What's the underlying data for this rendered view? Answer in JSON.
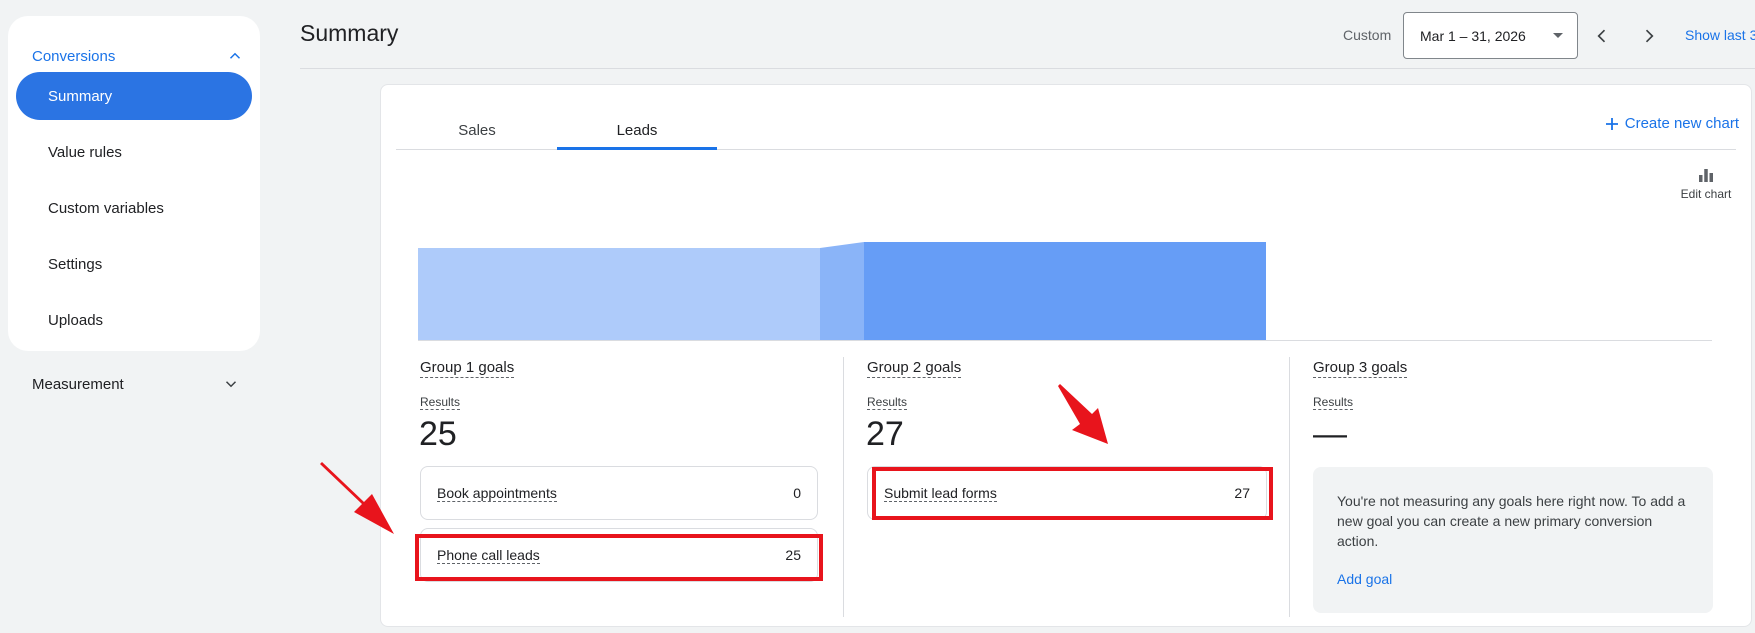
{
  "sidebar": {
    "header": "Conversions",
    "items": [
      {
        "label": "Summary",
        "active": true
      },
      {
        "label": "Value rules"
      },
      {
        "label": "Custom variables"
      },
      {
        "label": "Settings"
      },
      {
        "label": "Uploads"
      }
    ],
    "section": "Measurement"
  },
  "header": {
    "title": "Summary",
    "custom_label": "Custom",
    "date_range": "Mar 1 – 31, 2026",
    "show_last": "Show last 3"
  },
  "tabs": [
    {
      "label": "Sales"
    },
    {
      "label": "Leads",
      "active": true
    }
  ],
  "actions": {
    "create_chart": "Create new chart",
    "edit_chart": "Edit chart"
  },
  "groups": [
    {
      "title": "Group 1 goals",
      "results_label": "Results",
      "results_value": "25",
      "goals": [
        {
          "name": "Book appointments",
          "value": "0"
        },
        {
          "name": "Phone call leads",
          "value": "25"
        }
      ]
    },
    {
      "title": "Group 2 goals",
      "results_label": "Results",
      "results_value": "27",
      "goals": [
        {
          "name": "Submit lead forms",
          "value": "27"
        }
      ]
    },
    {
      "title": "Group 3 goals",
      "results_label": "Results",
      "results_value": "—",
      "empty_message": "You're not measuring any goals here right now. To add a new goal you can create a new primary conversion action.",
      "add_goal": "Add goal"
    }
  ],
  "colors": {
    "accent": "#1a73e8",
    "active_nav": "#2b74e3",
    "funnel_group1": "#aecbfa",
    "funnel_group2": "#669df6",
    "annotation": "#e8141c"
  },
  "icons": [
    "chevron-up-icon",
    "chevron-down-icon",
    "chevron-left-icon",
    "chevron-right-icon",
    "plus-icon",
    "bar-chart-icon",
    "arrow-icon"
  ]
}
